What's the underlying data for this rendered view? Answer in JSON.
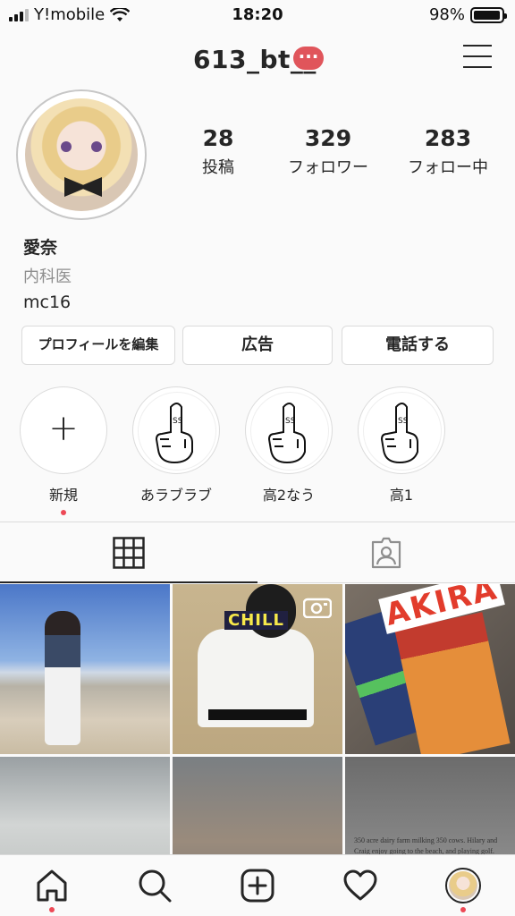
{
  "status_bar": {
    "carrier": "Y!mobile",
    "time": "18:20",
    "battery": "98%",
    "battery_level": 0.98
  },
  "header": {
    "username": "613_bt__",
    "notification_badge": "···",
    "menu_icon": "hamburger-icon"
  },
  "profile": {
    "stats": [
      {
        "value": "28",
        "label": "投稿"
      },
      {
        "value": "329",
        "label": "フォロワー"
      },
      {
        "value": "283",
        "label": "フォロー中"
      }
    ],
    "name": "愛奈",
    "category": "内科医",
    "bio": "mc16"
  },
  "buttons": {
    "edit_profile": "プロフィールを編集",
    "promotions": "広告",
    "call": "電話する"
  },
  "highlights": [
    {
      "label": "新規",
      "icon": "plus-icon"
    },
    {
      "label": "あラブラブ",
      "icon": "middle-finger-icon"
    },
    {
      "label": "高2なう",
      "icon": "middle-finger-icon"
    },
    {
      "label": "高1",
      "icon": "middle-finger-icon"
    }
  ],
  "tabs": [
    {
      "icon": "grid-icon"
    },
    {
      "icon": "tagged-person-icon"
    }
  ],
  "grid": {
    "post2_sticker": "CHILL",
    "post3_title": "AKIRA",
    "post6_text": "350 acre dairy farm milking 350 cows. Hilary and Craig enjoy going to the beach, and playing golf."
  },
  "bottom_nav": [
    {
      "icon": "home-icon"
    },
    {
      "icon": "search-icon"
    },
    {
      "icon": "add-post-icon"
    },
    {
      "icon": "heart-icon"
    },
    {
      "icon": "profile-avatar-icon"
    }
  ],
  "colors": {
    "badge": "#e0555b",
    "notification_dot": "#ed4956",
    "border": "#dbdbdb",
    "text": "#262626",
    "muted": "#8e8e8e"
  }
}
